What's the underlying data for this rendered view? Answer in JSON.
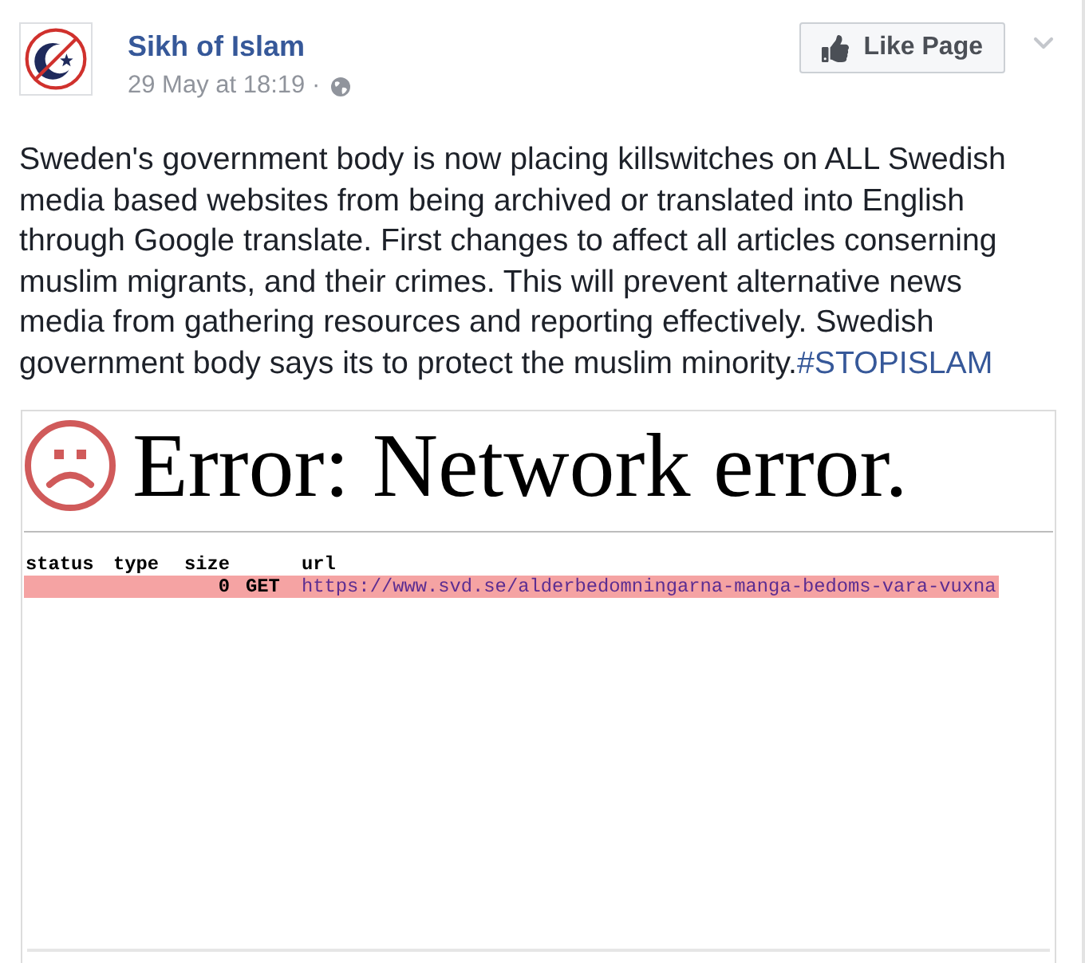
{
  "post": {
    "page_name": "Sikh of Islam",
    "timestamp": "29 May at 18:19 ·",
    "like_button": "Like Page",
    "text": "Sweden's government body is now placing killswitches on ALL Swedish media based websites from being archived or translated into English through Google translate. First changes to affect all articles conserning muslim migrants, and their crimes. This will prevent alternative news media from gathering resources and reporting effectively. Swedish government body says its to protect the muslim minority.",
    "hashtag": "#STOPISLAM"
  },
  "screenshot": {
    "error_title": "Error: Network error.",
    "network_table": {
      "headers": [
        "status",
        "type",
        "size",
        "url"
      ],
      "rows": [
        {
          "failed": true,
          "size": "0",
          "column_4": "GET",
          "url": "https://www.svd.se/alderbedomningarna-manga-bedoms-vara-vuxna"
        }
      ]
    }
  }
}
